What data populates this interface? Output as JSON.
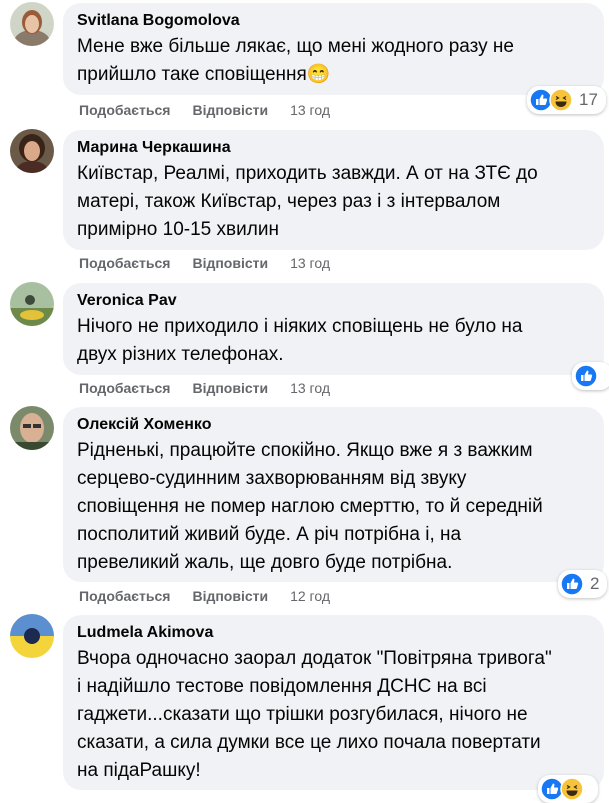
{
  "comments": [
    {
      "author": "Svitlana Bogomolova",
      "text": "Мене вже більше лякає, що мені жодного разу не\nприйшло таке сповіщення😁",
      "like_label": "Подобається",
      "reply_label": "Відповісти",
      "time": "13 год",
      "reactions": [
        "like-icon",
        "laugh-icon"
      ],
      "reaction_count": "17"
    },
    {
      "author": "Марина Черкашина",
      "text": "Київстар, Реалмі, приходить завжди. А от на ЗТЄ до\nматері, також Київстар, через раз і з інтервалом\nпримірно 10-15 хвилин",
      "like_label": "Подобається",
      "reply_label": "Відповісти",
      "time": "13 год"
    },
    {
      "author": "Veronica Pav",
      "text": "Нічого не приходило і ніяких сповіщень не було на\nдвух різних телефонах.",
      "like_label": "Подобається",
      "reply_label": "Відповісти",
      "time": "13 год",
      "reactions": [
        "like-icon"
      ],
      "reaction_count": ""
    },
    {
      "author": "Олексій Хоменко",
      "text": "Рідненькі, працюйте спокійно. Якщо вже я з важким\nсерцево-судинним захворюванням від звуку\nсповіщення не помер наглою смерттю, то й середній\nпосполитий живий буде. А річ потрібна і, на\nпревеликий жаль, ще довго буде потрібна.",
      "like_label": "Подобається",
      "reply_label": "Відповісти",
      "time": "12 год",
      "reactions": [
        "like-icon"
      ],
      "reaction_count": "2"
    },
    {
      "author": "Ludmela Akimova",
      "text": "Вчора одночасно заорал додаток \"Повітряна тривога\"\nі надійшло тестове повідомлення ДСНС на всі\nгаджети...сказати що трішки розгубилася, нічого не\nсказати, а сила думки все це лихо почала повертати\nна підаРашку!",
      "reactions": [
        "like-icon",
        "laugh-icon"
      ],
      "reaction_count": ""
    }
  ],
  "colors": {
    "bubble": "#f0f2f5",
    "like_blue": "#1877f2",
    "meta_gray": "#65676b"
  }
}
